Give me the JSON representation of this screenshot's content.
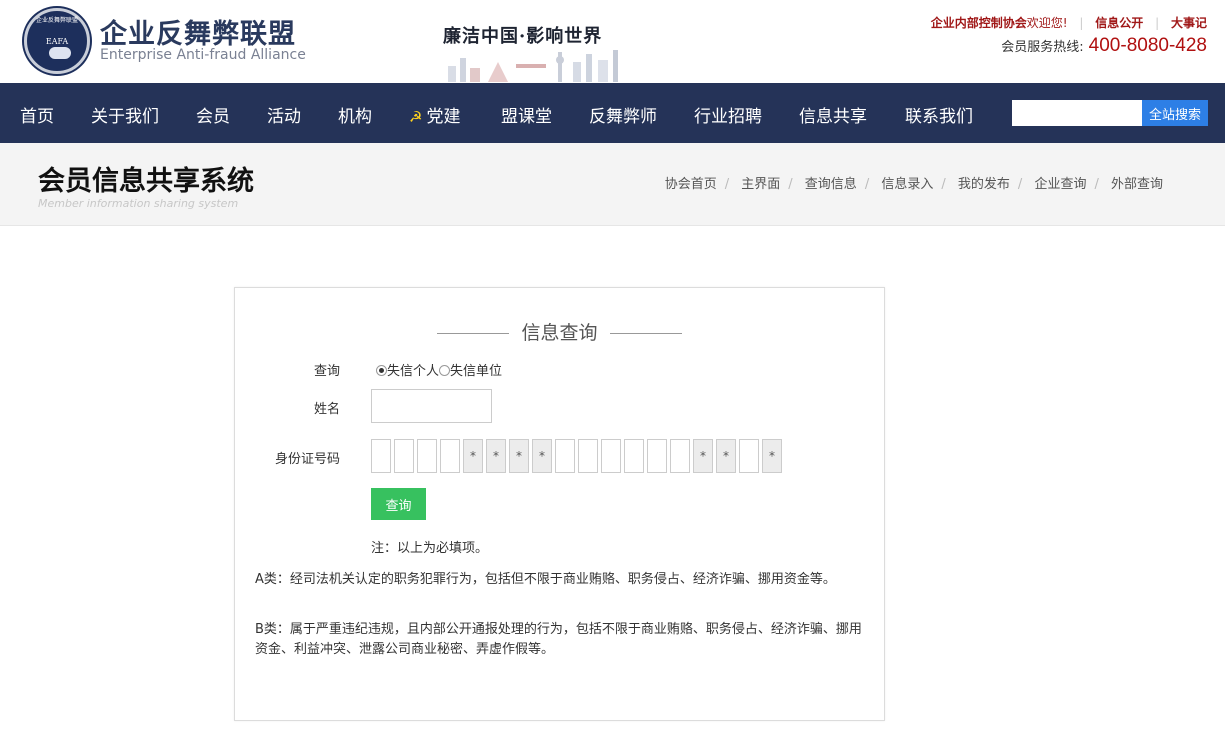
{
  "header": {
    "logo_cn": "企业反舞弊联盟",
    "logo_en": "Enterprise Anti-fraud Alliance",
    "emblem_ring": "企业反舞弊联盟",
    "emblem_abbr": "EAFA",
    "slogan": "廉洁中国·影响世界",
    "org_name": "企业内部控制协会",
    "welcome": "欢迎您!",
    "link_info": "信息公开",
    "link_events": "大事记",
    "hotline_label": "会员服务热线:",
    "hotline_number": "400-8080-428"
  },
  "nav": {
    "items": [
      "首页",
      "关于我们",
      "会员",
      "活动",
      "机构",
      "党建",
      "盟课堂",
      "反舞弊师",
      "行业招聘",
      "信息共享",
      "联系我们"
    ],
    "search_placeholder": "",
    "search_button": "全站搜索"
  },
  "subhead": {
    "title": "会员信息共享系统",
    "subtitle_en": "Member information sharing system",
    "breadcrumbs": [
      "协会首页",
      "主界面",
      "查询信息",
      "信息录入",
      "我的发布",
      "企业查询",
      "外部查询"
    ]
  },
  "form": {
    "title": "信息查询",
    "query_label": "查询",
    "radio_options": [
      "失信个人",
      "失信单位"
    ],
    "selected_option": "失信个人",
    "name_label": "姓名",
    "name_value": "",
    "id_label": "身份证号码",
    "id_boxes": [
      "",
      "",
      "",
      "",
      "*",
      "*",
      "*",
      "*",
      "",
      "",
      "",
      "",
      "",
      "",
      "*",
      "*",
      "",
      "*"
    ],
    "submit_label": "查询",
    "note": "注：以上为必填项。",
    "desc_a": "A类：经司法机关认定的职务犯罪行为，包括但不限于商业贿赂、职务侵占、经济诈骗、挪用资金等。",
    "desc_b": "B类：属于严重违纪违规，且内部公开通报处理的行为，包括不限于商业贿赂、职务侵占、经济诈骗、挪用资金、利益冲突、泄露公司商业秘密、弄虚作假等。"
  },
  "colors": {
    "nav_bg": "#253358",
    "accent_red": "#a01818",
    "search_blue": "#2d7fe6",
    "submit_green": "#37c15f"
  }
}
